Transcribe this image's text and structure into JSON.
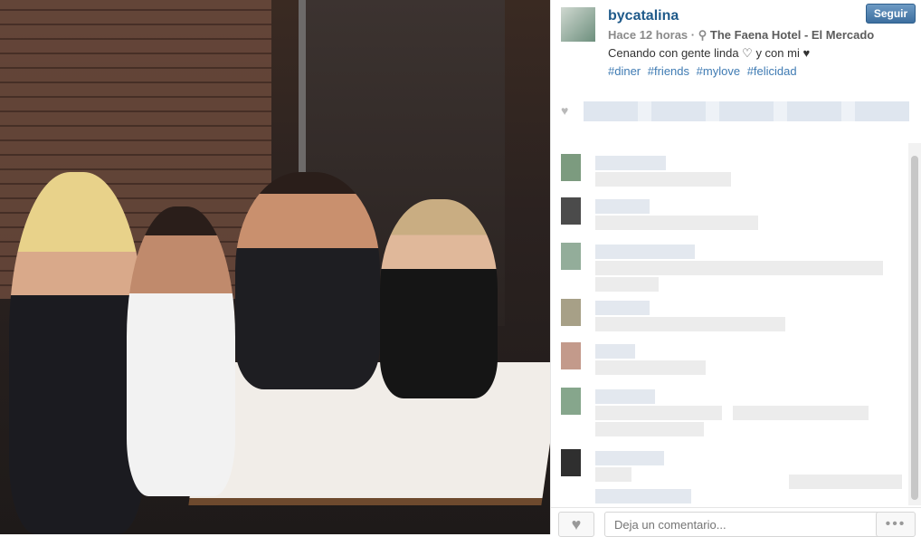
{
  "post": {
    "username": "bycatalina",
    "follow_label": "Seguir",
    "time": "Hace 12 horas",
    "separator": "·",
    "location": "The Faena Hotel - El Mercado",
    "caption": "Cenando con gente linda ♡ y con mi ♥",
    "hashtags": [
      "#diner",
      "#friends",
      "#mylove",
      "#felicidad"
    ]
  },
  "comment_box": {
    "placeholder": "Deja un comentario...",
    "more_label": "•••"
  },
  "icons": {
    "heart": "heart-icon",
    "location": "location-pin-icon",
    "more": "more-icon"
  },
  "colors": {
    "username": "#1f5a8a",
    "hashtag": "#3f7bb3",
    "follow_button": "#3d6f9f"
  }
}
